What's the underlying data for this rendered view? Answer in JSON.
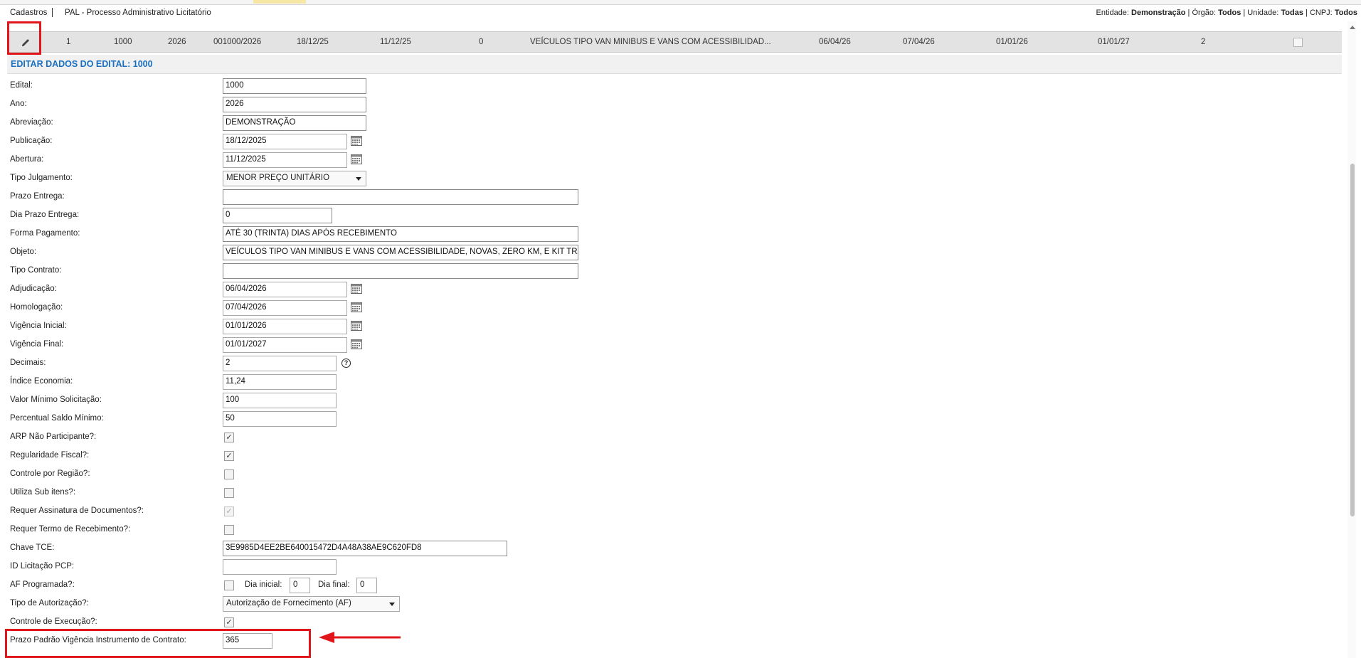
{
  "topbar": {
    "breadcrumb_root": "Cadastros",
    "module_title": "PAL - Processo Administrativo Licitatório",
    "entity_prefix": "Entidade:",
    "entity_value": "Demonstração",
    "orgao_prefix": " | Órgão:",
    "orgao_value": "Todos",
    "unidade_prefix": " | Unidade:",
    "unidade_value": "Todas",
    "cnpj_prefix": " | CNPJ:",
    "cnpj_value": "Todos"
  },
  "grid_row": {
    "col1": "1",
    "col2": "1000",
    "col3": "2026",
    "col4": "001000/2026",
    "col5": "18/12/25",
    "col6": "11/12/25",
    "col7": "0",
    "col8": "VEÍCULOS TIPO VAN MINIBUS E VANS COM ACESSIBILIDAD...",
    "col9": "06/04/26",
    "col10": "07/04/26",
    "col11": "01/01/26",
    "col12": "01/01/27",
    "col13": "2"
  },
  "section_title": "EDITAR DADOS DO EDITAL: 1000",
  "form": {
    "edital": {
      "label": "Edital:",
      "value": "1000"
    },
    "ano": {
      "label": "Ano:",
      "value": "2026"
    },
    "abreviacao": {
      "label": "Abreviação:",
      "value": "DEMONSTRAÇÃO"
    },
    "publicacao": {
      "label": "Publicação:",
      "value": "18/12/2025"
    },
    "abertura": {
      "label": "Abertura:",
      "value": "11/12/2025"
    },
    "tipo_julgamento": {
      "label": "Tipo Julgamento:",
      "value": "MENOR PREÇO UNITÁRIO"
    },
    "prazo_entrega": {
      "label": "Prazo Entrega:",
      "value": ""
    },
    "dia_prazo_entrega": {
      "label": "Dia Prazo Entrega:",
      "value": "0"
    },
    "forma_pagamento": {
      "label": "Forma Pagamento:",
      "value": "ATÉ 30 (TRINTA) DIAS APÓS RECEBIMENTO"
    },
    "objeto": {
      "label": "Objeto:",
      "value": "VEÍCULOS TIPO VAN MINIBUS E VANS COM ACESSIBILIDADE, NOVAS, ZERO KM, E KIT TRANS"
    },
    "tipo_contrato": {
      "label": "Tipo Contrato:",
      "value": ""
    },
    "adjudicacao": {
      "label": "Adjudicação:",
      "value": "06/04/2026"
    },
    "homologacao": {
      "label": "Homologação:",
      "value": "07/04/2026"
    },
    "vigencia_inicial": {
      "label": "Vigência Inicial:",
      "value": "01/01/2026"
    },
    "vigencia_final": {
      "label": "Vigência Final:",
      "value": "01/01/2027"
    },
    "decimais": {
      "label": "Decimais:",
      "value": "2"
    },
    "indice_economia": {
      "label": "Índice Economia:",
      "value": "11,24"
    },
    "valor_minimo": {
      "label": "Valor Mínimo Solicitação:",
      "value": "100"
    },
    "percentual_saldo": {
      "label": "Percentual Saldo Mínimo:",
      "value": "50"
    },
    "arp_nao_participante": {
      "label": "ARP Não Participante?:",
      "checked": true
    },
    "regularidade_fiscal": {
      "label": "Regularidade Fiscal?:",
      "checked": true
    },
    "controle_regiao": {
      "label": "Controle por Região?:",
      "checked": false
    },
    "utiliza_sub_itens": {
      "label": "Utiliza Sub itens?:",
      "checked": false
    },
    "requer_assinatura": {
      "label": "Requer Assinatura de Documentos?:",
      "checked": true
    },
    "requer_termo": {
      "label": "Requer Termo de Recebimento?:",
      "checked": false
    },
    "chave_tce": {
      "label": "Chave TCE:",
      "value": "3E9985D4EE2BE640015472D4A48A38AE9C620FD8"
    },
    "id_licitacao_pcp": {
      "label": "ID Licitação PCP:",
      "value": ""
    },
    "af_programada": {
      "label": "AF Programada?:",
      "checked": false,
      "dia_inicial_label": "Dia inicial:",
      "dia_inicial": "0",
      "dia_final_label": "Dia final:",
      "dia_final": "0"
    },
    "tipo_autorizacao": {
      "label": "Tipo de Autorização?:",
      "value": "Autorização de Fornecimento (AF)"
    },
    "controle_execucao": {
      "label": "Controle de Execução?:",
      "checked": true
    },
    "prazo_padrao": {
      "label": "Prazo Padrão Vigência Instrumento de Contrato:",
      "value": "365"
    }
  },
  "colors": {
    "accent": "#1a6fbf",
    "highlight": "#e0161b",
    "row_bg": "#e3e3e3"
  },
  "icons": {
    "edit": "pencil-icon",
    "calendar": "calendar-icon",
    "help": "help-icon",
    "arrow": "left-arrow-icon"
  }
}
